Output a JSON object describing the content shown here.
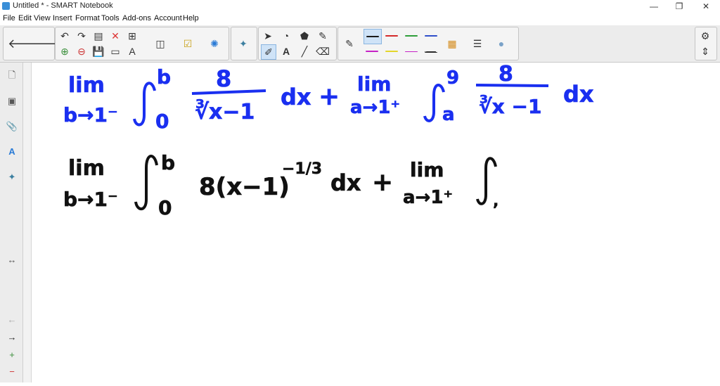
{
  "window": {
    "title": "Untitled * - SMART Notebook",
    "minimize": "—",
    "restore": "❐",
    "close": "✕"
  },
  "menu": [
    "File",
    "Edit",
    "View",
    "Insert",
    "Format",
    "Tools",
    "Add-ons",
    "Account",
    "Help"
  ],
  "toolbar": {
    "back_icon": "🡐",
    "forward_icon": "🡒",
    "undo_icon": "↶",
    "redo_icon": "↷",
    "pen_colors": [
      "#1a1a1a",
      "#d42a2a",
      "#2e9e3a",
      "#2f4fc9",
      "#c623c6",
      "#e3d62a",
      "#2a2a2a"
    ]
  },
  "sidebar": {
    "page_sorter_icon": "🗋",
    "gallery_icon": "▣",
    "attachments_icon": "📎",
    "properties_icon": "A",
    "addons_icon": "✦",
    "resize_icon": "↔",
    "prev_page_icon": "←",
    "next_page_icon": "→",
    "add_page_icon": "+",
    "delete_page_icon": "−"
  },
  "canvas": {
    "ink_blue": "#1a2ff0",
    "ink_black": "#111111",
    "line1": {
      "lim1": "lim",
      "sub1": "b→1⁻",
      "int_upper1": "b",
      "int_lower1": "0",
      "numer1": "8",
      "denom1": "∛x−1",
      "dx1": "dx",
      "plus": "+",
      "lim2": "lim",
      "sub2": "a→1⁺",
      "int_upper2": "9",
      "int_lower2": "a",
      "numer2": "8",
      "denom2": "∛x −1",
      "dx2": "dx"
    },
    "line2": {
      "lim1": "lim",
      "sub1": "b→1⁻",
      "int_upper1": "b",
      "int_lower1": "0",
      "body": "8(x−1)",
      "exponent": "−1/3",
      "dx": "dx",
      "plus": "+",
      "lim2": "lim",
      "sub2": "a→1⁺",
      "int_lower2": ","
    }
  }
}
